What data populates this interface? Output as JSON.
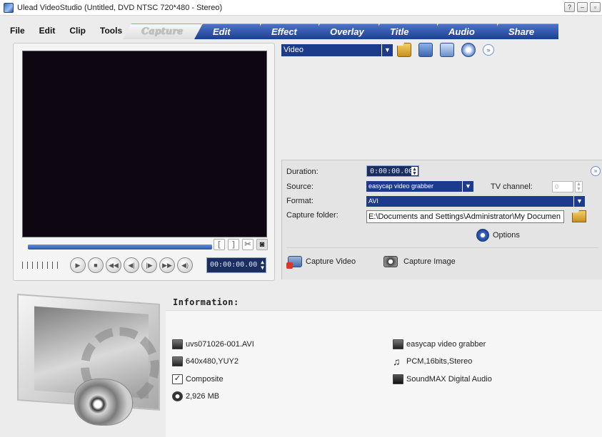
{
  "window": {
    "title": "Ulead VideoStudio (Untitled, DVD NTSC 720*480 - Stereo)",
    "buttons": [
      "?",
      "–",
      "▫"
    ]
  },
  "menu": [
    "File",
    "Edit",
    "Clip",
    "Tools"
  ],
  "tabs": [
    "Capture",
    "Edit",
    "Effect",
    "Overlay",
    "Title",
    "Audio",
    "Share"
  ],
  "active_tab": "Capture",
  "preview": {
    "timecode": "00:00:00.00",
    "trim_buttons": [
      "[",
      "]",
      "✂",
      "◙"
    ]
  },
  "source_dropdown": {
    "value": "Video"
  },
  "capture_settings": {
    "duration_label": "Duration:",
    "duration_value": "0:00:00.00",
    "source_label": "Source:",
    "source_value": "easycap video grabber",
    "tv_channel_label": "TV channel:",
    "tv_channel_value": "0",
    "format_label": "Format:",
    "format_value": "AVI",
    "folder_label": "Capture folder:",
    "folder_value": "E:\\Documents and Settings\\Administrator\\My Documen",
    "options_label": "Options",
    "capture_video_label": "Capture Video",
    "capture_image_label": "Capture Image"
  },
  "information": {
    "title": "Information:",
    "left": [
      "uvs071026-001.AVI",
      "640x480,YUY2",
      "Composite",
      "2,926 MB"
    ],
    "right": [
      "easycap video grabber",
      "PCM,16bits,Stereo",
      "SoundMAX Digital Audio"
    ]
  },
  "colors": {
    "tab_blue": "#1a3f96",
    "select_blue": "#1d3b8c",
    "timecode_bg": "#1c2e5e"
  }
}
